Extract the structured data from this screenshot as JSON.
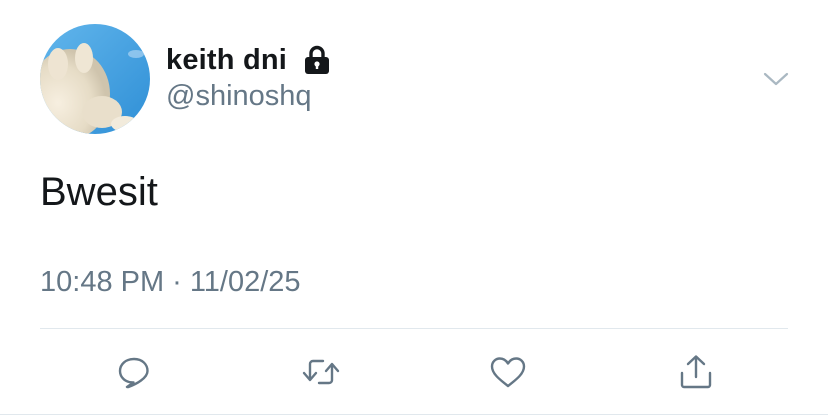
{
  "user": {
    "display_name": "keith dni",
    "handle": "@shinoshq",
    "protected_icon": "lock-icon",
    "avatar_icon": "avatar-image"
  },
  "tweet": {
    "text": "Bwesit",
    "time": "10:48 PM",
    "separator": "·",
    "date": "11/02/25"
  },
  "menu": {
    "icon": "chevron-down-icon"
  },
  "actions": [
    {
      "name": "reply",
      "icon": "reply-icon"
    },
    {
      "name": "retweet",
      "icon": "retweet-icon"
    },
    {
      "name": "like",
      "icon": "heart-icon"
    },
    {
      "name": "share",
      "icon": "share-icon"
    }
  ],
  "colors": {
    "primary_text": "#14171a",
    "secondary_text": "#657786",
    "divider": "#e1e8ed",
    "avatar_sky": "#4aa3df"
  }
}
